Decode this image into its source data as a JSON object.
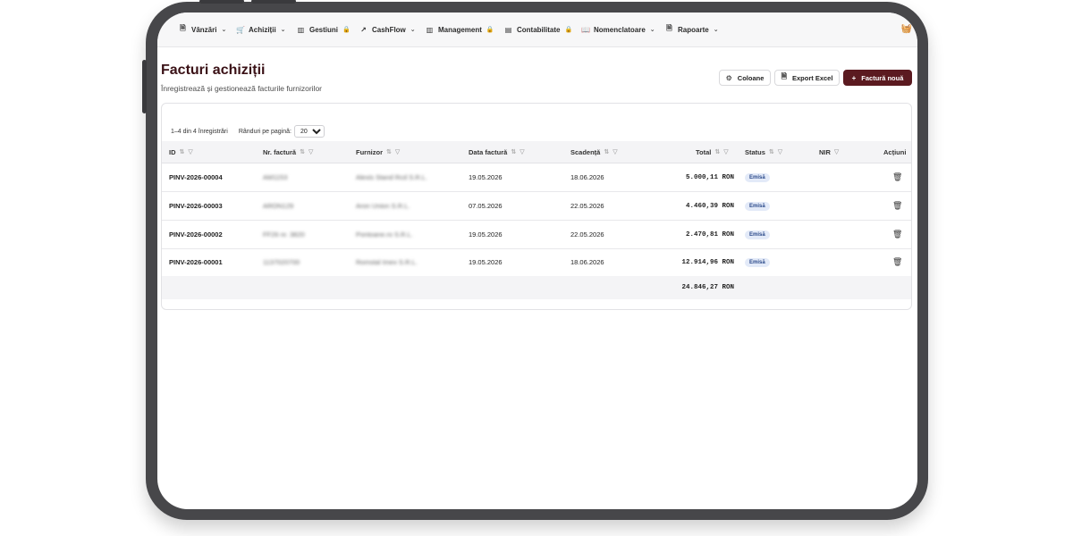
{
  "nav": {
    "items": [
      {
        "label": "Vânzări",
        "icon": "document-icon",
        "caret": "⌄"
      },
      {
        "label": "Achiziții",
        "icon": "cart-icon",
        "caret": "⌄"
      },
      {
        "label": "Gestiuni",
        "icon": "bar-chart-icon",
        "lock": "🔒"
      },
      {
        "label": "CashFlow",
        "icon": "trend-icon",
        "caret": "⌄"
      },
      {
        "label": "Management",
        "icon": "bar-chart-icon",
        "lock": "🔒"
      },
      {
        "label": "Contabilitate",
        "icon": "ledger-icon",
        "lock": "🔒"
      },
      {
        "label": "Nomenclatoare",
        "icon": "book-icon",
        "caret": "⌄"
      },
      {
        "label": "Rapoarte",
        "icon": "report-icon",
        "caret": "⌄"
      }
    ]
  },
  "header": {
    "title": "Facturi achiziții",
    "subtitle": "Înregistrează și gestionează facturile furnizorilor",
    "columns_button": "Coloane",
    "export_button": "Export Excel",
    "new_button": "Factură nouă"
  },
  "pager": {
    "summary": "1–4 din 4 înregistrări",
    "per_page_label": "Rânduri pe pagină:",
    "per_page_value": "20"
  },
  "table": {
    "headers": {
      "id": "ID",
      "nr": "Nr. factură",
      "supplier": "Furnizor",
      "date": "Data factură",
      "due": "Scadență",
      "total": "Total",
      "status": "Status",
      "nir": "NIR",
      "actions": "Acțiuni"
    },
    "rows": [
      {
        "id": "PINV-2026-00004",
        "nr": "AM1153",
        "supplier": "Alexis Stand Rcd S.R.L.",
        "date": "19.05.2026",
        "due": "18.06.2026",
        "total": "5.000,11 RON",
        "status": "Emisă"
      },
      {
        "id": "PINV-2026-00003",
        "nr": "ARON129",
        "supplier": "Aron Union S.R.L.",
        "date": "07.05.2026",
        "due": "22.05.2026",
        "total": "4.460,39 RON",
        "status": "Emisă"
      },
      {
        "id": "PINV-2026-00002",
        "nr": "FF26 nr. 3820",
        "supplier": "Pontoane.ro S.R.L.",
        "date": "19.05.2026",
        "due": "22.05.2026",
        "total": "2.470,81 RON",
        "status": "Emisă"
      },
      {
        "id": "PINV-2026-00001",
        "nr": "1137020700",
        "supplier": "Romstal Imex S.R.L.",
        "date": "19.05.2026",
        "due": "18.06.2026",
        "total": "12.914,96 RON",
        "status": "Emisă"
      }
    ],
    "footer_total": "24.846,27 RON"
  },
  "colors": {
    "primary": "#5b1a20",
    "title": "#3a1116",
    "badge_bg": "#e3eaf8",
    "device_frame": "#47474a"
  }
}
